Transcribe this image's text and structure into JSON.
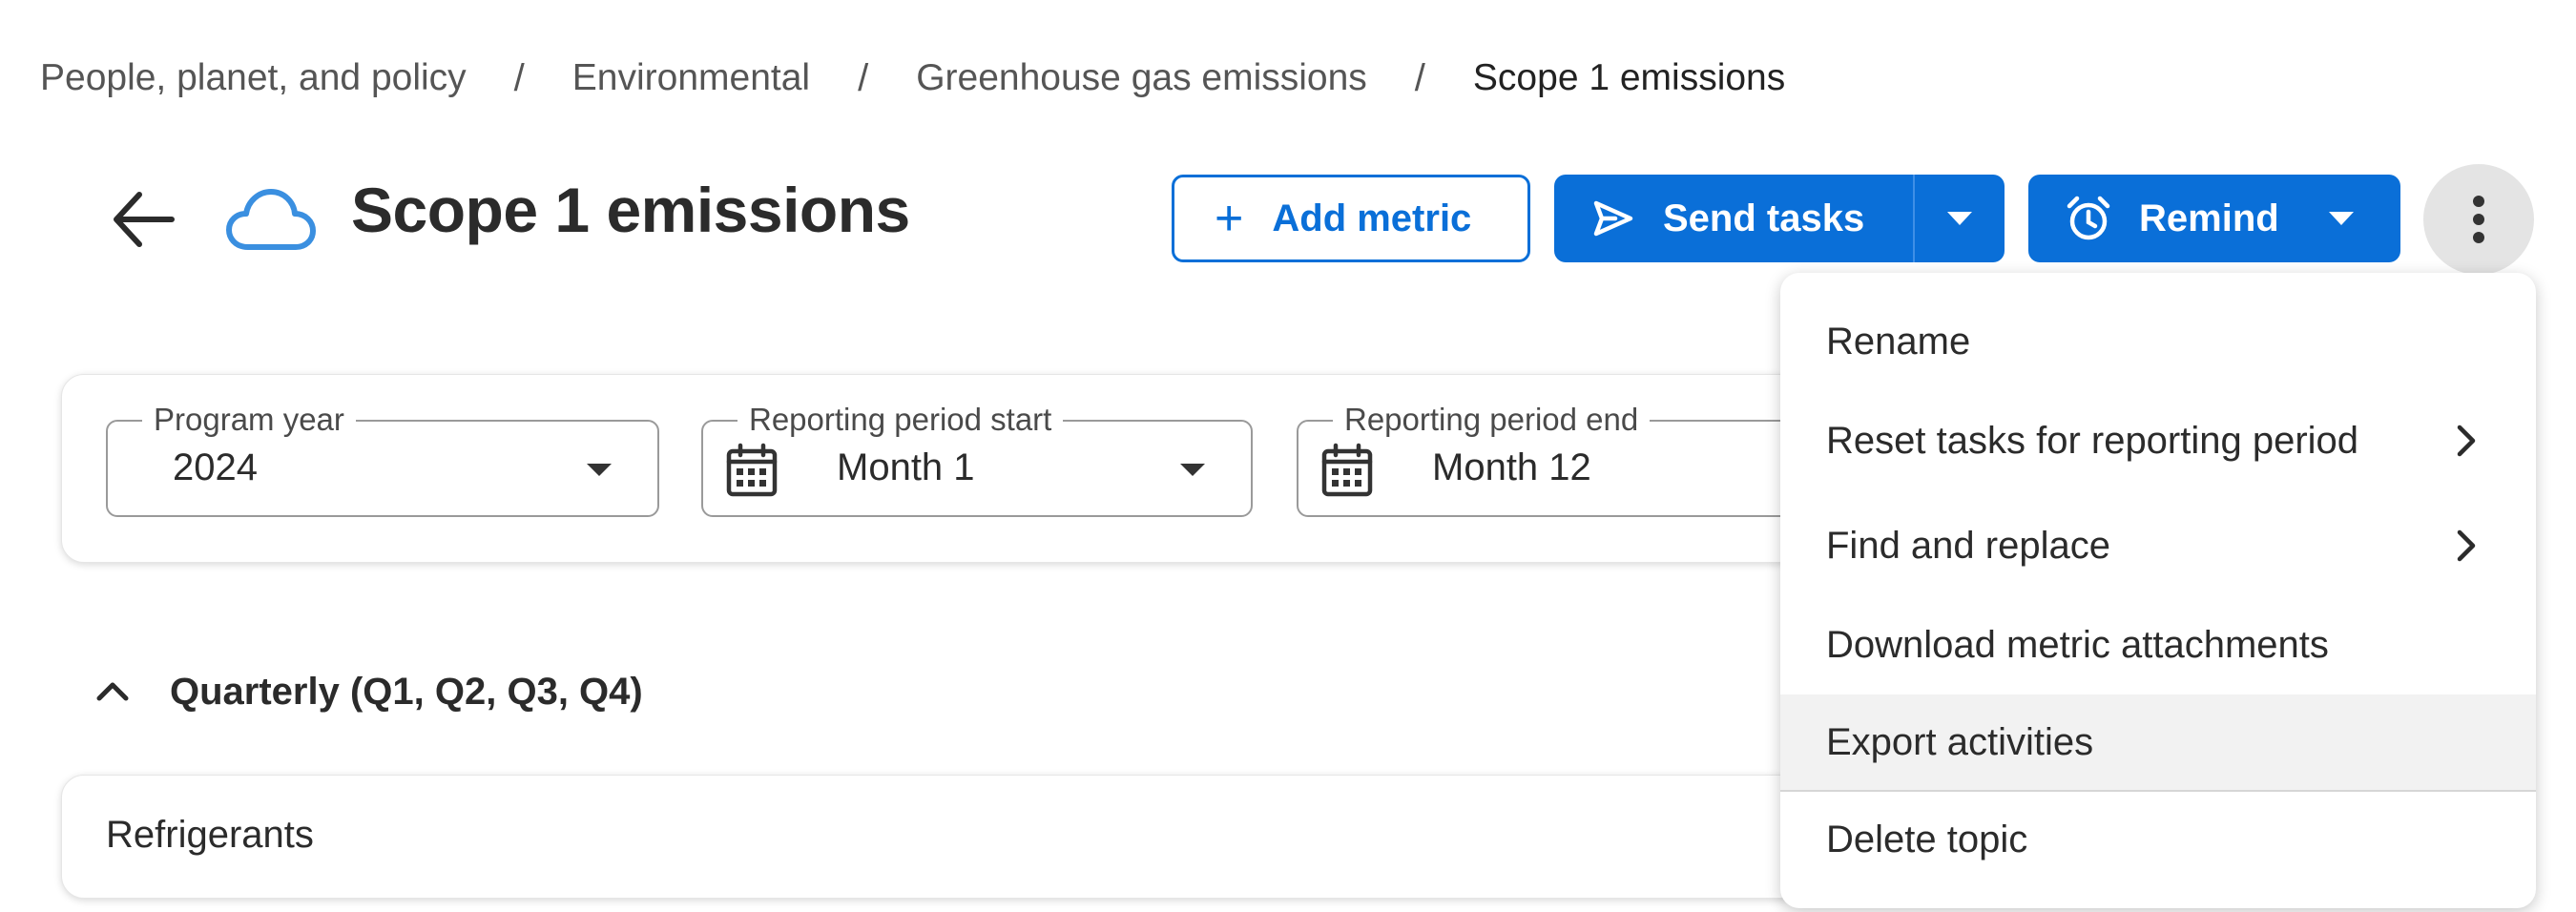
{
  "breadcrumb": {
    "items": [
      "People, planet, and policy",
      "Environmental",
      "Greenhouse gas emissions",
      "Scope 1 emissions"
    ],
    "separator": "/"
  },
  "header": {
    "title": "Scope 1 emissions",
    "add_metric_label": "Add metric",
    "send_tasks_label": "Send tasks",
    "remind_label": "Remind"
  },
  "filters": {
    "program_year": {
      "label": "Program year",
      "value": "2024"
    },
    "period_start": {
      "label": "Reporting period start",
      "value": "Month 1"
    },
    "period_end": {
      "label": "Reporting period end",
      "value": "Month 12"
    }
  },
  "section": {
    "title": "Quarterly (Q1, Q2, Q3, Q4)",
    "rows": [
      "Refrigerants"
    ]
  },
  "menu": {
    "items": [
      {
        "label": "Rename",
        "submenu": false
      },
      {
        "label": "Reset tasks for reporting period",
        "submenu": true
      },
      {
        "label": "Find and replace",
        "submenu": true
      },
      {
        "label": "Download metric attachments",
        "submenu": false
      },
      {
        "label": "Export activities",
        "submenu": false,
        "highlighted": true
      },
      {
        "label": "Delete topic",
        "submenu": false
      }
    ]
  },
  "colors": {
    "primary": "#0a6fd8",
    "cloud_icon": "#3a8fe0",
    "menu_highlight": "#f2f2f2",
    "kebab_bg": "#e4e4e4"
  },
  "icons": {
    "back": "arrow-left-icon",
    "topic": "cloud-icon",
    "add": "plus-icon",
    "send": "send-icon",
    "remind": "alarm-clock-icon",
    "more": "kebab-icon",
    "calendar": "calendar-icon",
    "collapse": "chevron-up-icon",
    "submenu": "chevron-right-icon"
  }
}
